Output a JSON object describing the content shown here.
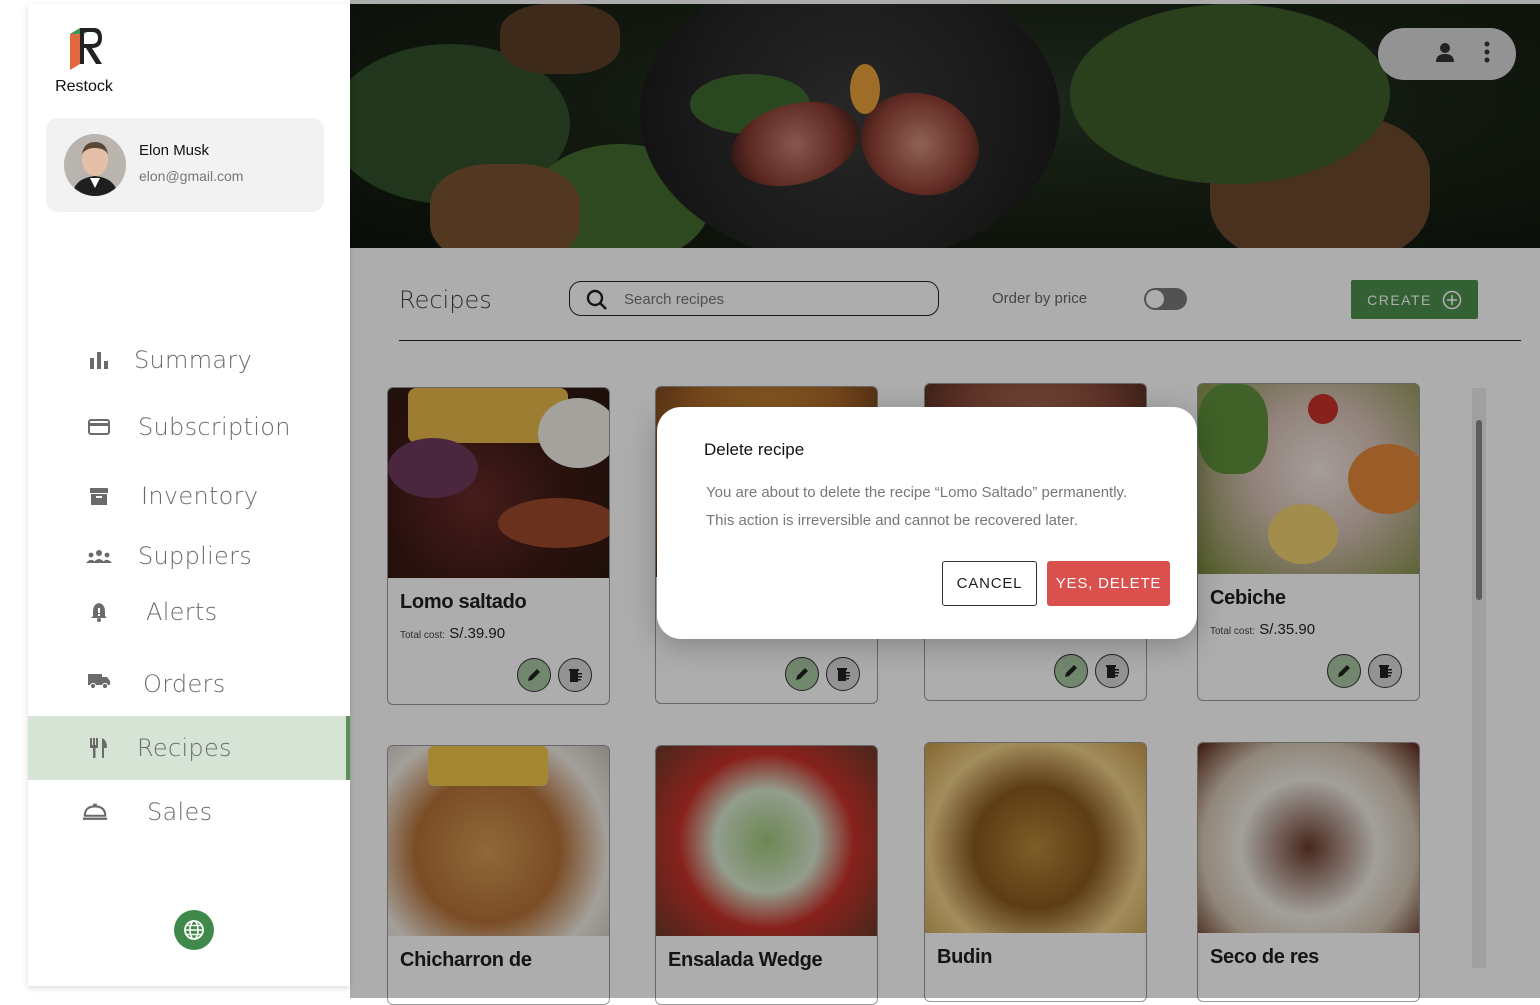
{
  "app": {
    "name": "Restock"
  },
  "user": {
    "name": "Elon Musk",
    "email": "elon@gmail.com"
  },
  "sidebar": {
    "items": [
      {
        "label": "Summary",
        "icon": "bar-chart-icon"
      },
      {
        "label": "Subscription",
        "icon": "credit-card-icon"
      },
      {
        "label": "Inventory",
        "icon": "archive-box-icon"
      },
      {
        "label": "Suppliers",
        "icon": "group-icon"
      },
      {
        "label": "Alerts",
        "icon": "bell-icon"
      },
      {
        "label": "Orders",
        "icon": "truck-icon"
      },
      {
        "label": "Recipes",
        "icon": "fork-knife-icon",
        "active": true
      },
      {
        "label": "Sales",
        "icon": "cloche-icon"
      }
    ]
  },
  "header": {
    "title": "Recipes",
    "search_placeholder": "Search recipes",
    "order_label": "Order by price",
    "order_toggle_on": false,
    "create_label": "CREATE"
  },
  "recipes": [
    {
      "name": "Lomo saltado",
      "cost_label": "Total cost:",
      "cost": "S/.39.90"
    },
    {
      "name": "",
      "cost_label": "",
      "cost": ""
    },
    {
      "name": "",
      "cost_label": "",
      "cost": ""
    },
    {
      "name": "Cebiche",
      "cost_label": "Total cost:",
      "cost": "S/.35.90"
    },
    {
      "name": "Chicharron de",
      "cost_label": "",
      "cost": ""
    },
    {
      "name": "Ensalada Wedge",
      "cost_label": "",
      "cost": ""
    },
    {
      "name": "Budin",
      "cost_label": "",
      "cost": ""
    },
    {
      "name": "Seco de res",
      "cost_label": "",
      "cost": ""
    }
  ],
  "dialog": {
    "title": "Delete recipe",
    "line1": "You are about to delete the recipe “Lomo Saltado” permanently.",
    "line2": "This action is irreversible and cannot be recovered later.",
    "cancel_label": "CANCEL",
    "confirm_label": "YES, DELETE"
  },
  "colors": {
    "accent": "#4d8f4d",
    "active_nav_bg": "#d6e4d5",
    "danger": "#d9504d"
  }
}
